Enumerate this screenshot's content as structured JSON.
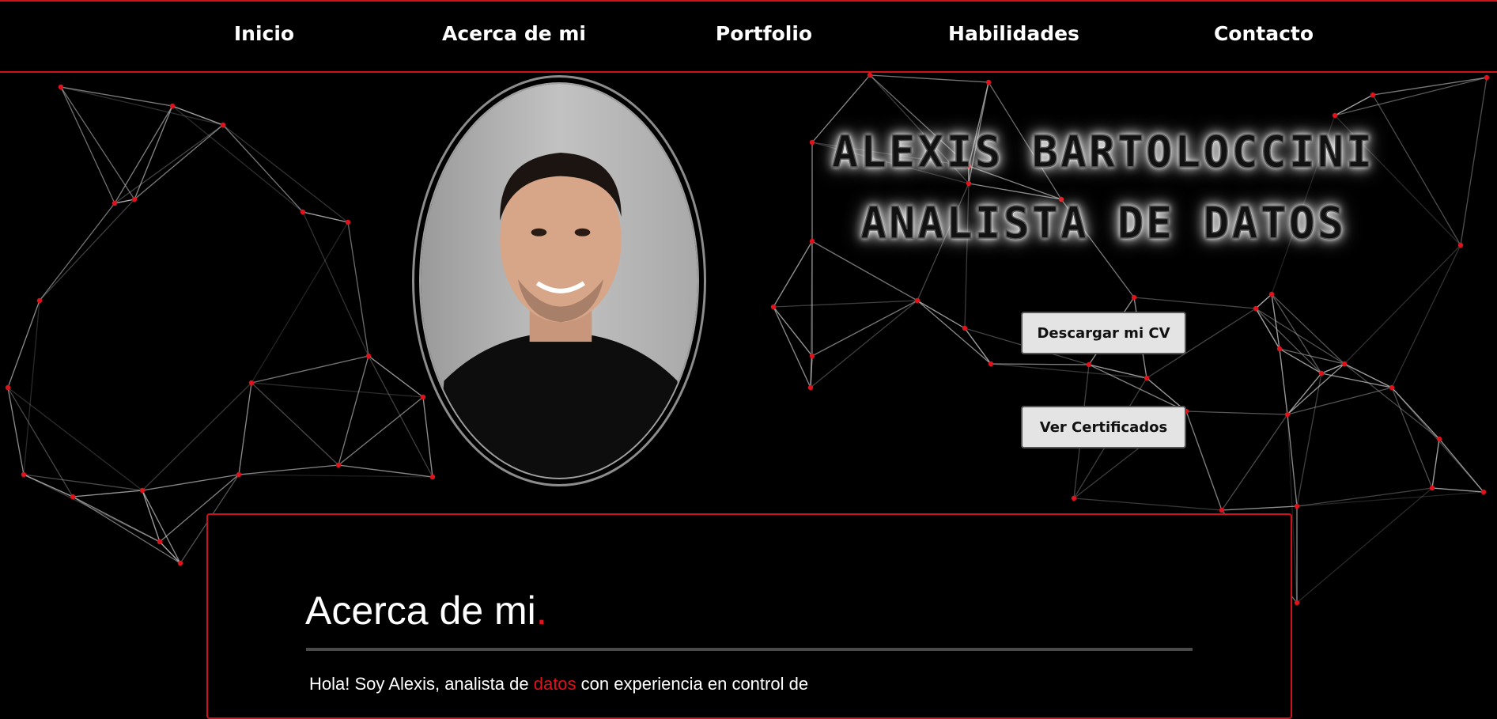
{
  "nav": {
    "items": [
      "Inicio",
      "Acerca de mi",
      "Portfolio",
      "Habilidades",
      "Contacto"
    ]
  },
  "hero": {
    "name": "ALEXIS BARTOLOCCINI",
    "role": "ANALISTA DE DATOS",
    "cv_button": "Descargar mi CV",
    "cert_button": "Ver Certificados"
  },
  "about": {
    "title": "Acerca de mi",
    "title_dot": ".",
    "text_before": "Hola! Soy Alexis, analista de ",
    "text_highlight": "datos",
    "text_after": " con experiencia en control de"
  },
  "colors": {
    "accent": "#d0121b",
    "background": "#000000",
    "button": "#e4e4e4"
  }
}
